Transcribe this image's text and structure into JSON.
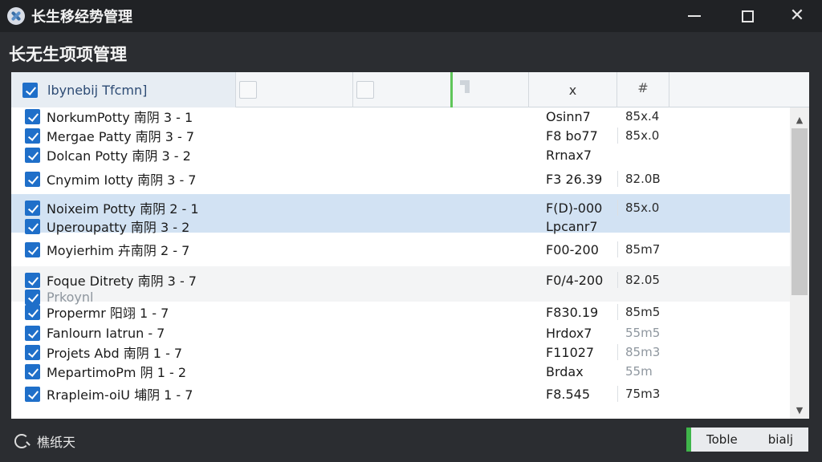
{
  "window": {
    "title": "长生移经势管理"
  },
  "section": {
    "heading": "长无生项项管理"
  },
  "table": {
    "header_label": "lbynebij Tfcmn]",
    "col_x_label": "x",
    "col_hash_label": "#"
  },
  "rows": [
    {
      "name": "NorkumPotty 南阴 3 - 1",
      "code": "Osinn7",
      "size": "85x.4"
    },
    {
      "name": "Mergae Patty 南阴 3 - 7",
      "code": "F8 bo77",
      "size": "85x.0"
    },
    {
      "name": "Dolcan Potty 南阴 3 - 2",
      "code": "Rrnax7",
      "size": ""
    },
    {
      "name": "Cnymim Iotty 南阴 3 - 7",
      "code": "F3 26.39",
      "size": "82.0B"
    },
    {
      "name": "Noixeim Potty 南阴 2 - 1",
      "code": "F(D)-000",
      "size": "85x.0"
    },
    {
      "name": "Uperoupatty 南阴 3 - 2",
      "code": "Lpcanr7",
      "size": ""
    },
    {
      "name": "Moyierhim 卉南阴 2 - 7",
      "code": "F00-200",
      "size": "85m7"
    },
    {
      "name": "Foque Ditrety 南阴 3 - 7",
      "code": "F0/4-200",
      "size": "82.05"
    },
    {
      "name": "Prkoynl",
      "code": "",
      "size": ""
    },
    {
      "name": "Propermr 阳翊 1 - 7",
      "code": "F830.19",
      "size": "85m5"
    },
    {
      "name": "Fanlourn  Iatrun - 7",
      "code": "Hrdox7",
      "size": "55m5"
    },
    {
      "name": "Projets Abd 南阴 1 - 7",
      "code": "F11027",
      "size": "85m3"
    },
    {
      "name": "MepartimoPm 阴 1 - 2",
      "code": "Brdax",
      "size": "55m"
    },
    {
      "name": "Rrapleim-oiU 埔阴 1 - 7",
      "code": "F8.545",
      "size": "75m3"
    }
  ],
  "footer": {
    "status_text": "樵纸天",
    "button_left": "Toble",
    "button_right": "bialj"
  },
  "colors": {
    "accent": "#1f6fc9",
    "selection": "#d2e2f3",
    "green": "#3fb54a"
  }
}
